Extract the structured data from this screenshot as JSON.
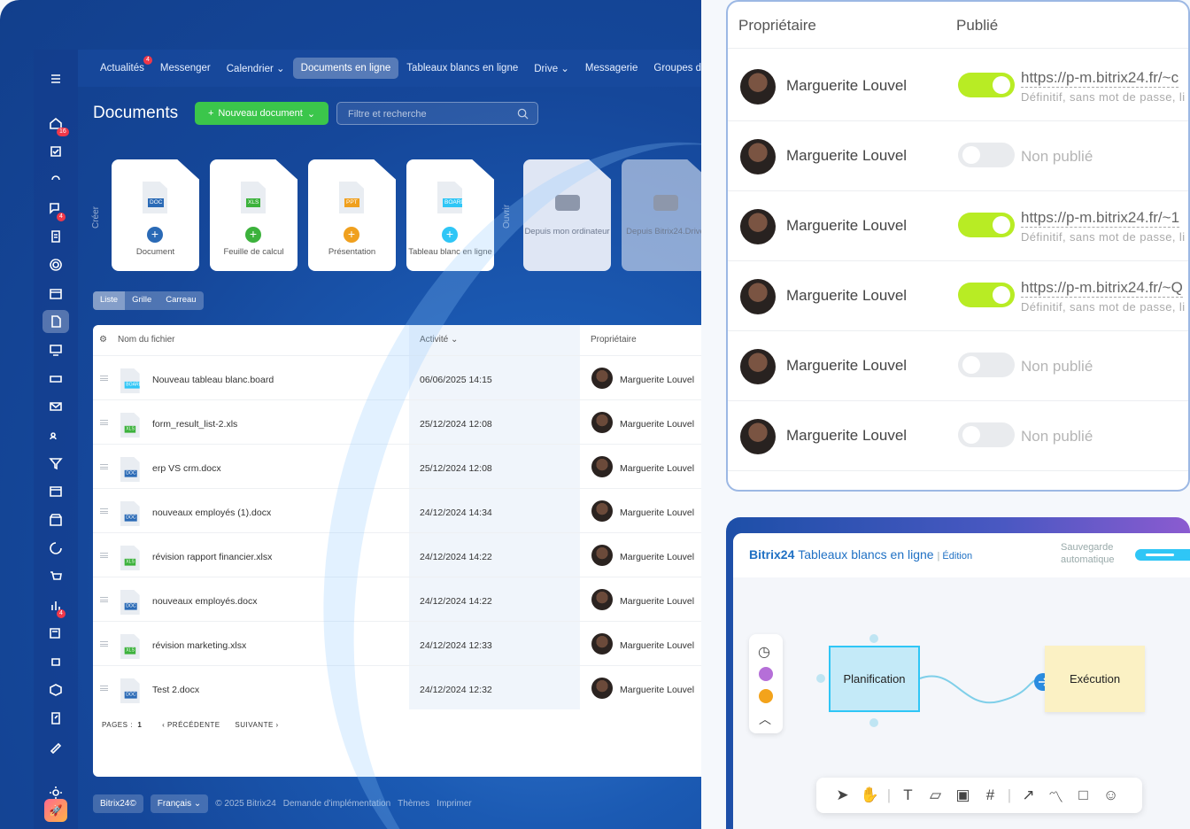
{
  "nav": {
    "items": [
      {
        "label": "Actualités",
        "badge": "4"
      },
      {
        "label": "Messenger"
      },
      {
        "label": "Calendrier ⌄"
      },
      {
        "label": "Documents en ligne",
        "selected": true
      },
      {
        "label": "Tableaux blancs en ligne"
      },
      {
        "label": "Drive ⌄"
      },
      {
        "label": "Messagerie"
      },
      {
        "label": "Groupes d"
      }
    ]
  },
  "sidebar": {
    "badges": {
      "tasks": "16",
      "feed": "4",
      "chat": "4"
    }
  },
  "page": {
    "title": "Documents",
    "new_button": "Nouveau document",
    "search_placeholder": "Filtre et recherche",
    "create_label": "Créer",
    "open_label": "Ouvrir"
  },
  "create_cards": [
    {
      "label": "Document",
      "tag": "DOC",
      "color": "#2a6ab6",
      "plus": "#2a6ab6"
    },
    {
      "label": "Feuille de calcul",
      "tag": "XLS",
      "color": "#3cb23c",
      "plus": "#3cb23c"
    },
    {
      "label": "Présentation",
      "tag": "PPT",
      "color": "#f0a01e",
      "plus": "#f0a01e"
    },
    {
      "label": "Tableau blanc en ligne",
      "tag": "BOARD",
      "color": "#2fc6f6",
      "plus": "#2fc6f6"
    }
  ],
  "open_cards": [
    {
      "label": "Depuis mon ordinateur"
    },
    {
      "label": "Depuis Bitrix24.Drive"
    }
  ],
  "view_modes": [
    "Liste",
    "Grille",
    "Carreau"
  ],
  "table": {
    "headers": {
      "name": "Nom du fichier",
      "activity": "Activité ⌄",
      "owner": "Propriétaire"
    },
    "rows": [
      {
        "name": "Nouveau tableau blanc.board",
        "date": "06/06/2025 14:15",
        "owner": "Marguerite Louvel",
        "tag": "BOARD",
        "color": "#2fc6f6"
      },
      {
        "name": "form_result_list-2.xls",
        "date": "25/12/2024 12:08",
        "owner": "Marguerite Louvel",
        "tag": "XLS",
        "color": "#3cb23c"
      },
      {
        "name": "erp VS crm.docx",
        "date": "25/12/2024 12:08",
        "owner": "Marguerite Louvel",
        "tag": "DOC",
        "color": "#2a6ab6"
      },
      {
        "name": "nouveaux employés (1).docx",
        "date": "24/12/2024 14:34",
        "owner": "Marguerite Louvel",
        "tag": "DOC",
        "color": "#2a6ab6"
      },
      {
        "name": "révision rapport financier.xlsx",
        "date": "24/12/2024 14:22",
        "owner": "Marguerite Louvel",
        "tag": "XLS",
        "color": "#3cb23c"
      },
      {
        "name": "nouveaux employés.docx",
        "date": "24/12/2024 14:22",
        "owner": "Marguerite Louvel",
        "tag": "DOC",
        "color": "#2a6ab6"
      },
      {
        "name": "révision marketing.xlsx",
        "date": "24/12/2024 12:33",
        "owner": "Marguerite Louvel",
        "tag": "XLS",
        "color": "#3cb23c"
      },
      {
        "name": "Test 2.docx",
        "date": "24/12/2024 12:32",
        "owner": "Marguerite Louvel",
        "tag": "DOC",
        "color": "#2a6ab6"
      }
    ],
    "pages_label": "PAGES :",
    "page": "1",
    "prev": "PRÉCÉDENTE",
    "next": "SUIVANTE"
  },
  "footer": {
    "brand": "Bitrix24©",
    "lang": "Français ⌄",
    "copyright": "© 2025 Bitrix24",
    "links": [
      "Demande d'implémentation",
      "Thèmes",
      "Imprimer"
    ]
  },
  "publish": {
    "headers": {
      "owner": "Propriétaire",
      "published": "Publié"
    },
    "rows": [
      {
        "owner": "Marguerite Louvel",
        "on": true,
        "url": "https://p-m.bitrix24.fr/~c",
        "sub": "Définitif, sans mot de passe, li"
      },
      {
        "owner": "Marguerite Louvel",
        "on": false,
        "status": "Non publié"
      },
      {
        "owner": "Marguerite Louvel",
        "on": true,
        "url": "https://p-m.bitrix24.fr/~1",
        "sub": "Définitif, sans mot de passe, li"
      },
      {
        "owner": "Marguerite Louvel",
        "on": true,
        "url": "https://p-m.bitrix24.fr/~Q",
        "sub": "Définitif, sans mot de passe, li"
      },
      {
        "owner": "Marguerite Louvel",
        "on": false,
        "status": "Non publié"
      },
      {
        "owner": "Marguerite Louvel",
        "on": false,
        "status": "Non publié"
      }
    ]
  },
  "board": {
    "logo_a": "Bitrix",
    "logo_b": "24",
    "logo_title": "Tableaux blancs en ligne",
    "mode": "Édition",
    "autosave": "Sauvegarde automatique",
    "node1": "Planification",
    "node2": "Exécution"
  }
}
